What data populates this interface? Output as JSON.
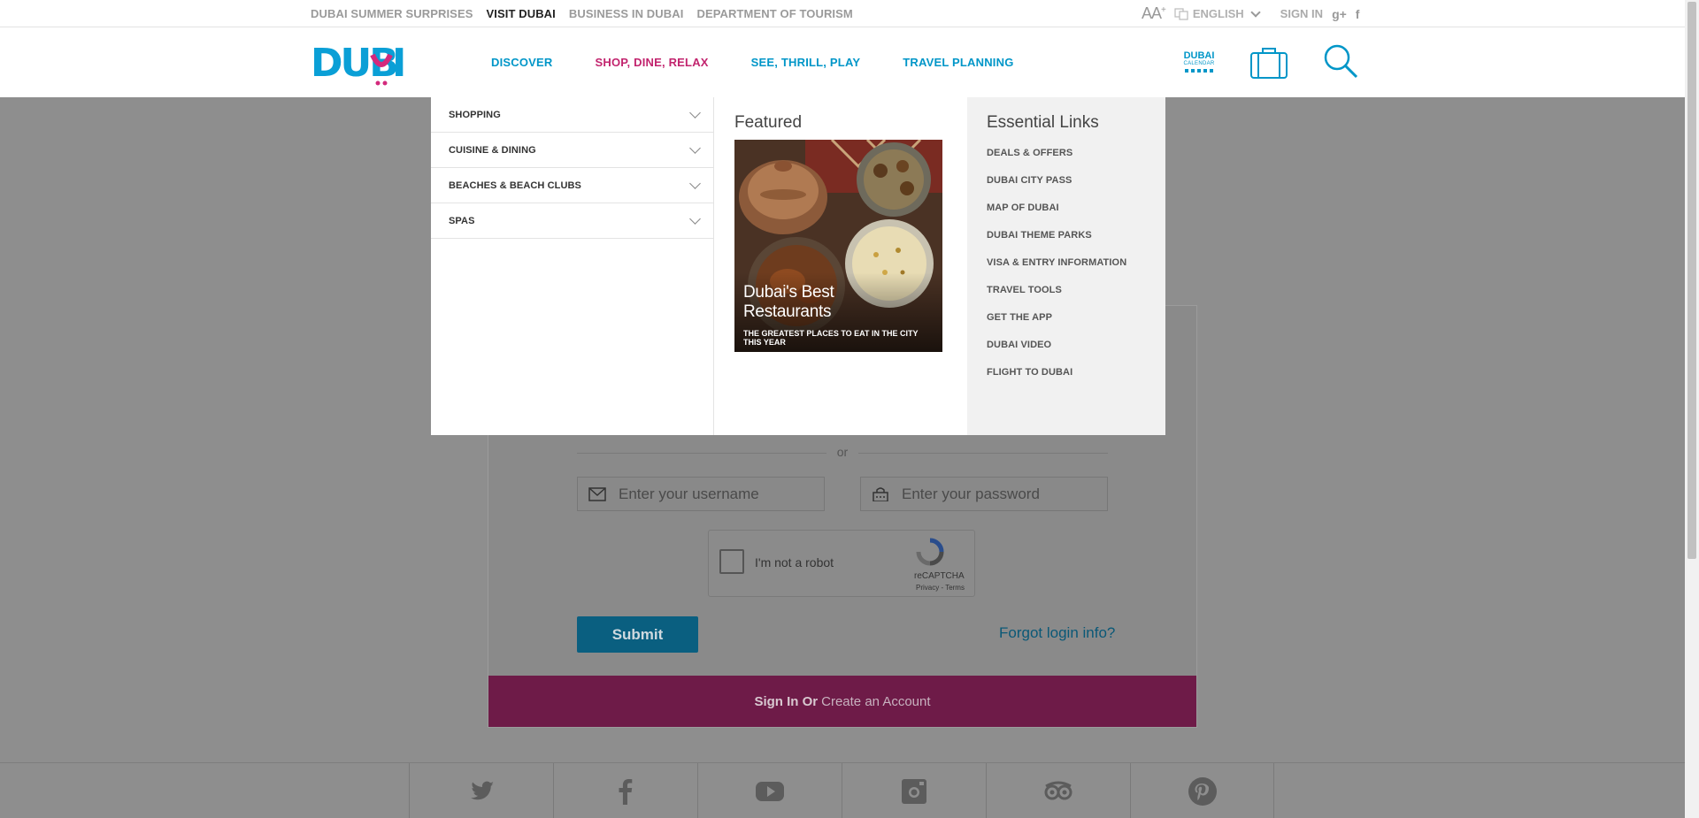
{
  "topbar": {
    "links": [
      "DUBAI SUMMER SURPRISES",
      "VISIT DUBAI",
      "BUSINESS IN DUBAI",
      "DEPARTMENT OF TOURISM"
    ],
    "font_size_label": "AA",
    "font_size_plus": "+",
    "language": "ENGLISH",
    "sign_in": "SIGN IN"
  },
  "header": {
    "nav": [
      "DISCOVER",
      "SHOP, DINE, RELAX",
      "SEE, THRILL, PLAY",
      "TRAVEL PLANNING"
    ],
    "calendar_title": "DUBAI",
    "calendar_sub": "CALENDAR",
    "colors": {
      "blue": "#0096c8",
      "magenta": "#c2246e"
    }
  },
  "mega_menu": {
    "categories": [
      "SHOPPING",
      "CUISINE & DINING",
      "BEACHES & BEACH CLUBS",
      "SPAS"
    ],
    "featured_heading": "Featured",
    "featured_title": "Dubai's Best Restaurants",
    "featured_subtitle": "THE GREATEST PLACES TO EAT IN THE CITY THIS YEAR",
    "essential_heading": "Essential Links",
    "essential_links": [
      "DEALS & OFFERS",
      "DUBAI CITY PASS",
      "MAP OF DUBAI",
      "DUBAI THEME PARKS",
      "VISA & ENTRY INFORMATION",
      "TRAVEL TOOLS",
      "GET THE APP",
      "DUBAI VIDEO",
      "FLIGHT TO DUBAI"
    ]
  },
  "login": {
    "or": "or",
    "username_placeholder": "Enter your username",
    "password_placeholder": "Enter your password",
    "captcha_label": "I'm not a robot",
    "captcha_brand": "reCAPTCHA",
    "captcha_links": "Privacy - Terms",
    "submit": "Submit",
    "forgot": "Forgot login info?",
    "signin_bold": "Sign In Or",
    "create_account": "Create an Account"
  },
  "footer": {
    "social": [
      "twitter-icon",
      "facebook-icon",
      "youtube-icon",
      "instagram-icon",
      "tripadvisor-icon",
      "pinterest-icon"
    ]
  }
}
